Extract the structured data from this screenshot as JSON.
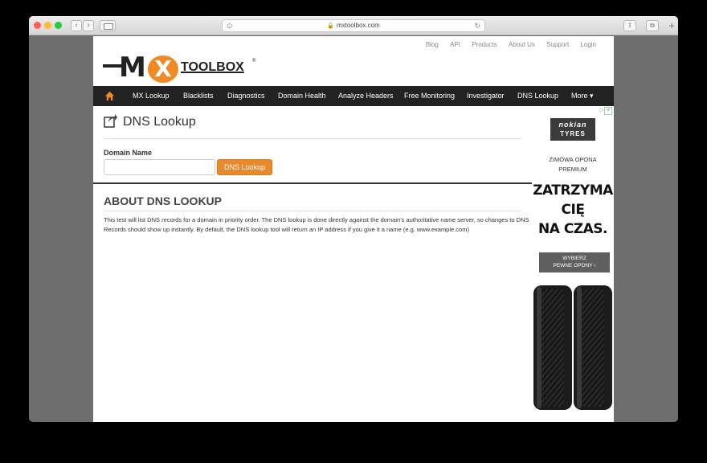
{
  "browser": {
    "url": "mxtoolbox.com"
  },
  "top_links": [
    "Blog",
    "API",
    "Products",
    "About Us",
    "Support",
    "Login"
  ],
  "logo": {
    "letter_m": "M",
    "letter_x": "X",
    "wordmark": "TOOLBOX",
    "registered": "®"
  },
  "nav": {
    "items": [
      "MX Lookup",
      "Blacklists",
      "Diagnostics",
      "Domain Health",
      "Analyze Headers",
      "Free Monitoring",
      "Investigator",
      "DNS Lookup",
      "More ▾"
    ]
  },
  "main": {
    "page_title": "DNS Lookup",
    "field_label": "Domain Name",
    "input_value": "",
    "input_placeholder": "",
    "submit_label": "DNS Lookup",
    "about_title": "ABOUT DNS LOOKUP",
    "about_text": "This test will list DNS records for a domain in priority order. The DNS lookup is done directly against the domain's authoritative name server, so changes to DNS Records should show up instantly. By default, the DNS lookup tool will return an IP address if you give it a name (e.g. www.example.com)"
  },
  "ad": {
    "brand": "nokian",
    "brand_sub": "TYRES",
    "sub_line1": "ZIMOWA OPONA",
    "sub_line2": "PREMIUM",
    "headline_line1": "ZATRZYMA",
    "headline_line2": "CIĘ",
    "headline_line3": "NA CZAS.",
    "cta_line1": "WYBIERZ",
    "cta_line2": "PEWNE OPONY ›",
    "close": "✕"
  },
  "colors": {
    "accent": "#e8892e",
    "nav_bg": "#222222"
  }
}
